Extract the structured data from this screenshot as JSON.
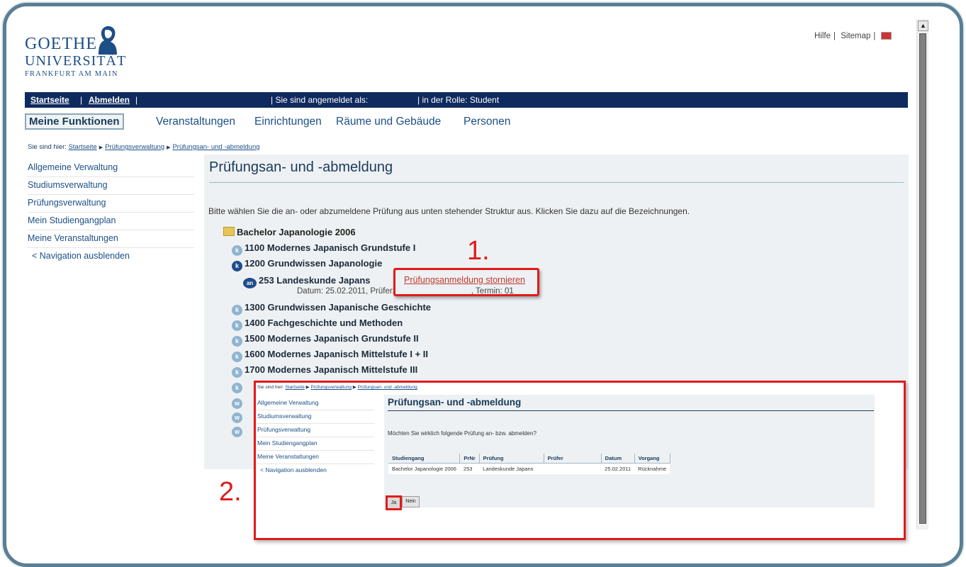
{
  "header": {
    "logo": {
      "line1": "GOETHE",
      "line2": "UNIVERSITÄT",
      "line3": "FRANKFURT AM MAIN"
    },
    "toplinks": {
      "hilfe": "Hilfe",
      "sep1": "|",
      "sitemap": "Sitemap",
      "sep2": "|"
    }
  },
  "navbar": {
    "startseite": "Startseite",
    "sep": "|",
    "abmelden": "Abmelden",
    "sep2": "|",
    "logged_in": "| Sie sind angemeldet als:",
    "role": "| in der Rolle: Student"
  },
  "menu": {
    "active": "Meine Funktionen",
    "items": [
      "Veranstaltungen",
      "Einrichtungen",
      "Räume und Gebäude",
      "Personen"
    ]
  },
  "breadcrumb": {
    "prefix": "Sie sind hier:",
    "items": [
      "Startseite",
      "Prüfungsverwaltung",
      "Prüfungsan- und -abmeldung"
    ]
  },
  "sidebar": {
    "items": [
      "Allgemeine Verwaltung",
      "Studiumsverwaltung",
      "Prüfungsverwaltung",
      "Mein Studiengangplan",
      "Meine Veranstaltungen"
    ],
    "toggle": "< Navigation ausblenden"
  },
  "main": {
    "title": "Prüfungsan- und -abmeldung",
    "instruction": "Bitte wählen Sie die an- oder abzumeldene Prüfung aus unten stehender Struktur aus. Klicken Sie dazu auf die Bezeichnungen.",
    "tree": {
      "root": "Bachelor Japanologie 2006",
      "nodes": [
        "1100 Modernes Japanisch Grundstufe I",
        "1200 Grundwissen Japanologie",
        "1300 Grundwissen Japanische Geschichte",
        "1400 Fachgeschichte und Methoden",
        "1500 Modernes Japanisch Grundstufe II",
        "1600 Modernes Japanisch Mittelstufe I + II",
        "1700 Modernes Japanisch Mittelstufe III"
      ],
      "exam": {
        "badge": "an",
        "label": "253 Landeskunde Japans",
        "link": "Prüfungsanmeldung stornieren",
        "detail": "Datum: 25.02.2011, Prüfer:",
        "termin": ", Termin: 01"
      },
      "badge_k": "k",
      "badge_w": "w"
    }
  },
  "annotations": {
    "step1": "1.",
    "step2": "2."
  },
  "inset": {
    "breadcrumb": {
      "prefix": "Sie sind hier:",
      "items": [
        "Startseite",
        "Prüfungsverwaltung",
        "Prüfungsan- und -abmeldung"
      ]
    },
    "sidebar": {
      "items": [
        "Allgemeine Verwaltung",
        "Studiumsverwaltung",
        "Prüfungsverwaltung",
        "Mein Studiengangplan",
        "Meine Veranstaltungen"
      ],
      "toggle": "< Navigation ausblenden"
    },
    "title": "Prüfungsan- und -abmeldung",
    "question": "Möchten Sie wirklich folgende Prüfung an- bzw. abmelden?",
    "table": {
      "headers": [
        "Studiengang",
        "PrNr",
        "Prüfung",
        "Prüfer",
        "Datum",
        "Vorgang"
      ],
      "row": [
        "Bachelor Japanologie 2006",
        "253",
        "Landeskunde Japans",
        "",
        "25.02.2011",
        "Rücknahme"
      ]
    },
    "buttons": {
      "ja": "Ja",
      "nein": "Nein"
    }
  },
  "colors": {
    "navbar": "#0f2a5e",
    "accent_red": "#e01b1b",
    "link_blue": "#1d4f86",
    "frame": "#5a7f94"
  }
}
